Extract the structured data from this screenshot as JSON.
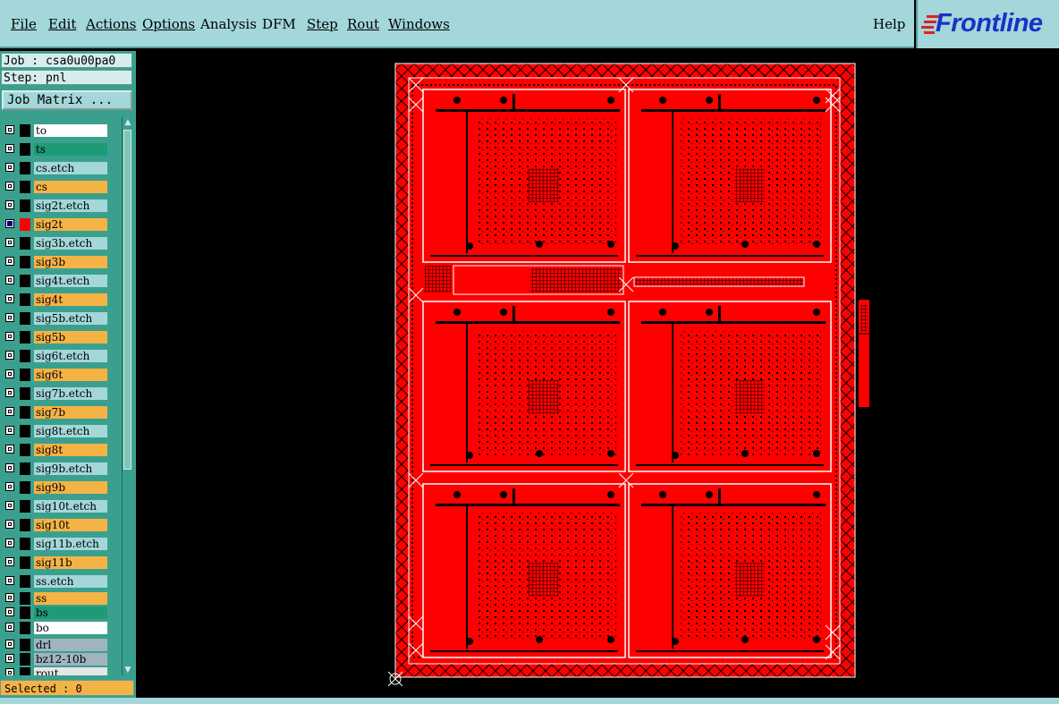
{
  "menu": {
    "file": "File",
    "edit": "Edit",
    "actions": "Actions",
    "options": "Options",
    "analysis": "Analysis",
    "dfm": "DFM",
    "step": "Step",
    "rout": "Rout",
    "windows": "Windows",
    "help": "Help"
  },
  "logo": {
    "text": "Frontline"
  },
  "job": {
    "label": "Job : csa0u00pa0",
    "step": "Step: pnl"
  },
  "matrix_button": "Job Matrix ...",
  "layers": [
    {
      "name": "to",
      "bg": "#ffffff",
      "checked": false
    },
    {
      "name": "ts",
      "bg": "#1e9a77",
      "checked": false
    },
    {
      "name": "cs.etch",
      "bg": "#a3d7d9",
      "checked": false
    },
    {
      "name": "cs",
      "bg": "#f5b346",
      "checked": false
    },
    {
      "name": "sig2t.etch",
      "bg": "#a3d7d9",
      "checked": false
    },
    {
      "name": "sig2t",
      "bg": "#f5b346",
      "checked": true,
      "active": true
    },
    {
      "name": "sig3b.etch",
      "bg": "#a3d7d9",
      "checked": false
    },
    {
      "name": "sig3b",
      "bg": "#f5b346",
      "checked": false
    },
    {
      "name": "sig4t.etch",
      "bg": "#a3d7d9",
      "checked": false
    },
    {
      "name": "sig4t",
      "bg": "#f5b346",
      "checked": false
    },
    {
      "name": "sig5b.etch",
      "bg": "#a3d7d9",
      "checked": false
    },
    {
      "name": "sig5b",
      "bg": "#f5b346",
      "checked": false
    },
    {
      "name": "sig6t.etch",
      "bg": "#a3d7d9",
      "checked": false
    },
    {
      "name": "sig6t",
      "bg": "#f5b346",
      "checked": false
    },
    {
      "name": "sig7b.etch",
      "bg": "#a3d7d9",
      "checked": false
    },
    {
      "name": "sig7b",
      "bg": "#f5b346",
      "checked": false
    },
    {
      "name": "sig8t.etch",
      "bg": "#a3d7d9",
      "checked": false
    },
    {
      "name": "sig8t",
      "bg": "#f5b346",
      "checked": false
    },
    {
      "name": "sig9b.etch",
      "bg": "#a3d7d9",
      "checked": false
    },
    {
      "name": "sig9b",
      "bg": "#f5b346",
      "checked": false
    },
    {
      "name": "sig10t.etch",
      "bg": "#a3d7d9",
      "checked": false
    },
    {
      "name": "sig10t",
      "bg": "#f5b346",
      "checked": false
    },
    {
      "name": "sig11b.etch",
      "bg": "#a3d7d9",
      "checked": false
    },
    {
      "name": "sig11b",
      "bg": "#f5b346",
      "checked": false
    },
    {
      "name": "ss.etch",
      "bg": "#a3d7d9",
      "checked": false
    },
    {
      "name": "ss",
      "bg": "#f5b346",
      "checked": false
    },
    {
      "name": "bs",
      "bg": "#1e9a77",
      "checked": false
    },
    {
      "name": "bo",
      "bg": "#ffffff",
      "checked": false
    },
    {
      "name": "drl",
      "bg": "#9fb4bf",
      "checked": false
    },
    {
      "name": "bz12-10b",
      "bg": "#9fb4bf",
      "checked": false
    },
    {
      "name": "rout",
      "bg": "#e6e6e6",
      "checked": false
    }
  ],
  "selected": "Selected : 0",
  "colors": {
    "board": "#ff0000",
    "outline": "#ffffff",
    "panel_bg": "#3aa08d",
    "menu_bg": "#a3d7d9"
  }
}
